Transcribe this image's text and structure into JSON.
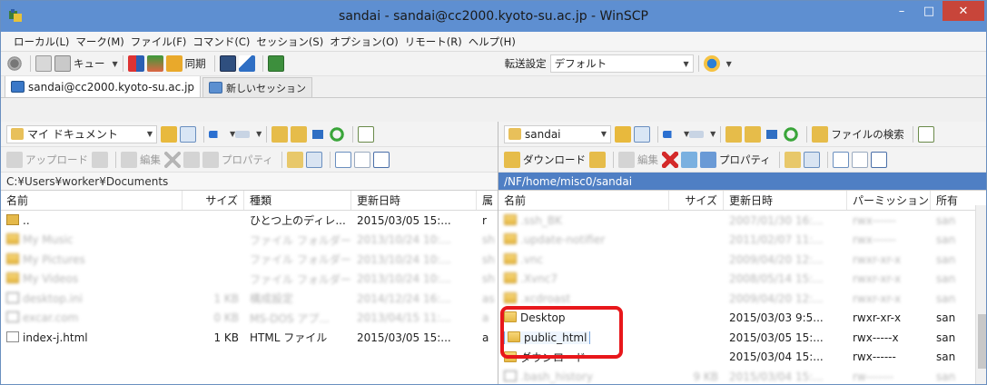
{
  "window": {
    "title": "sandai - sandai@cc2000.kyoto-su.ac.jp - WinSCP",
    "minimize": "–",
    "maximize": "□",
    "close": "✕"
  },
  "menu": [
    "ローカル(L)",
    "マーク(M)",
    "ファイル(F)",
    "コマンド(C)",
    "セッション(S)",
    "オプション(O)",
    "リモート(R)",
    "ヘルプ(H)"
  ],
  "toolbar": {
    "queue": "キュー",
    "sync": "同期",
    "transfer_label": "転送設定",
    "transfer_value": "デフォルト"
  },
  "tabs": {
    "session": "sandai@cc2000.kyoto-su.ac.jp",
    "new_session": "新しいセッション"
  },
  "left": {
    "location": "マイ ドキュメント",
    "upload": "アップロード",
    "edit": "編集",
    "properties": "プロパティ",
    "path": "C:¥Users¥worker¥Documents",
    "columns": [
      "名前",
      "サイズ",
      "種類",
      "更新日時",
      "属"
    ],
    "rows": [
      {
        "name": "..",
        "size": "",
        "type": "ひとつ上のディレ...",
        "date": "2015/03/05  15:...",
        "attr": "r",
        "blur": false,
        "icon": "parent"
      },
      {
        "name": "My Music",
        "size": "",
        "type": "ファイル フォルダー",
        "date": "2013/10/24  10:...",
        "attr": "sh",
        "blur": true,
        "icon": "folder"
      },
      {
        "name": "My Pictures",
        "size": "",
        "type": "ファイル フォルダー",
        "date": "2013/10/24  10:...",
        "attr": "sh",
        "blur": true,
        "icon": "folder"
      },
      {
        "name": "My Videos",
        "size": "",
        "type": "ファイル フォルダー",
        "date": "2013/10/24  10:...",
        "attr": "sh",
        "blur": true,
        "icon": "folder"
      },
      {
        "name": "desktop.ini",
        "size": "1 KB",
        "type": "構成設定",
        "date": "2014/12/24  16:...",
        "attr": "as",
        "blur": true,
        "icon": "file"
      },
      {
        "name": "excar.com",
        "size": "0 KB",
        "type": "MS-DOS アプ...",
        "date": "2013/04/15  11:...",
        "attr": "a",
        "blur": true,
        "icon": "file"
      },
      {
        "name": "index-j.html",
        "size": "1 KB",
        "type": "HTML ファイル",
        "date": "2015/03/05  15:...",
        "attr": "a",
        "blur": false,
        "icon": "file"
      }
    ]
  },
  "right": {
    "location": "sandai",
    "find_files": "ファイルの検索",
    "download": "ダウンロード",
    "edit": "編集",
    "properties": "プロパティ",
    "path": "/NF/home/misc0/sandai",
    "columns": [
      "名前",
      "サイズ",
      "更新日時",
      "パーミッション",
      "所有"
    ],
    "rows": [
      {
        "name": ".ssh_BK",
        "size": "",
        "date": "2007/01/30  16:...",
        "perm": "rwx------",
        "owner": "san",
        "blur": true,
        "icon": "folder"
      },
      {
        "name": ".update-notifier",
        "size": "",
        "date": "2011/02/07  11:...",
        "perm": "rwx------",
        "owner": "san",
        "blur": true,
        "icon": "folder"
      },
      {
        "name": ".vnc",
        "size": "",
        "date": "2009/04/20  12:...",
        "perm": "rwxr-xr-x",
        "owner": "san",
        "blur": true,
        "icon": "folder"
      },
      {
        "name": ".Xvnc7",
        "size": "",
        "date": "2008/05/14  15:...",
        "perm": "rwxr-xr-x",
        "owner": "san",
        "blur": true,
        "icon": "folder"
      },
      {
        "name": ".xcdroast",
        "size": "",
        "date": "2009/04/20  12:...",
        "perm": "rwxr-xr-x",
        "owner": "san",
        "blur": true,
        "icon": "folder"
      },
      {
        "name": "Desktop",
        "size": "",
        "date": "2015/03/03  9:5...",
        "perm": "rwxr-xr-x",
        "owner": "san",
        "blur": false,
        "icon": "folder"
      },
      {
        "name": "public_html",
        "size": "",
        "date": "2015/03/05  15:...",
        "perm": "rwx-----x",
        "owner": "san",
        "blur": false,
        "icon": "folder",
        "selected": true
      },
      {
        "name": "ダウンロード",
        "size": "",
        "date": "2015/03/04  15:...",
        "perm": "rwx------",
        "owner": "san",
        "blur": false,
        "icon": "folder"
      },
      {
        "name": ".bash_history",
        "size": "9 KB",
        "date": "2015/03/04  15:...",
        "perm": "rw-------",
        "owner": "san",
        "blur": true,
        "icon": "file"
      }
    ]
  },
  "colors": {
    "title_bar": "#5e8fd1",
    "path_bar_active": "#4f7fc4",
    "highlight": "#e8171b",
    "close_button": "#c8453a"
  }
}
